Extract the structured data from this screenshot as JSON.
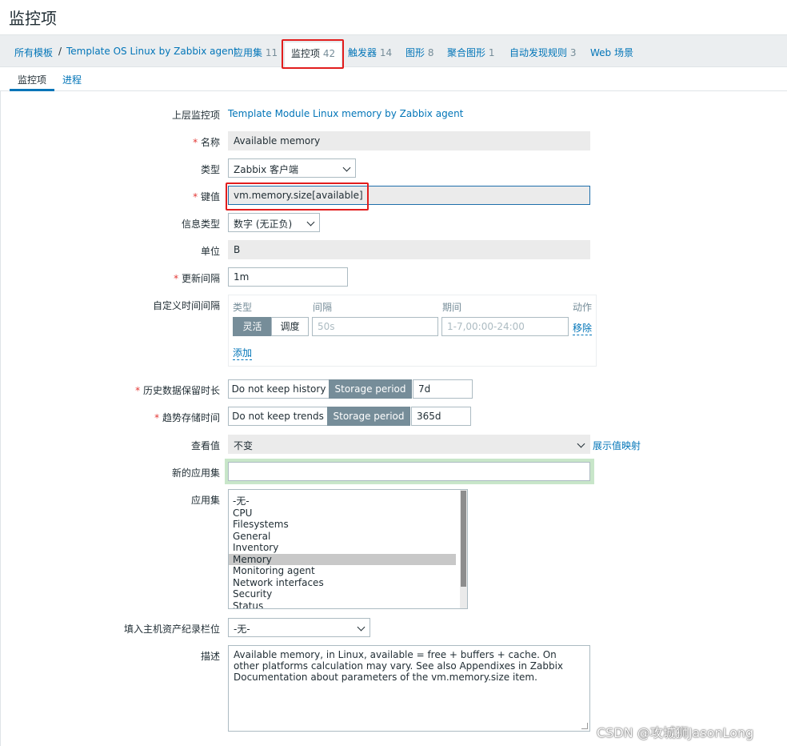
{
  "page": {
    "title": "监控项"
  },
  "breadcrumb": {
    "all_templates": "所有模板",
    "separator": "/",
    "template": "Template OS Linux by Zabbix agent"
  },
  "nav": [
    {
      "label": "应用集",
      "count": "11"
    },
    {
      "label": "监控项",
      "count": "42",
      "active": true
    },
    {
      "label": "触发器",
      "count": "14"
    },
    {
      "label": "图形",
      "count": "8"
    },
    {
      "label": "聚合图形",
      "count": "1"
    },
    {
      "label": "自动发现规则",
      "count": "3"
    },
    {
      "label": "Web 场景",
      "count": ""
    }
  ],
  "tabs": {
    "item": "监控项",
    "process": "进程"
  },
  "form": {
    "parent": {
      "label": "上层监控项",
      "value": "Template Module Linux memory by Zabbix agent"
    },
    "name": {
      "label": "名称",
      "value": "Available memory"
    },
    "type": {
      "label": "类型",
      "value": "Zabbix 客户端"
    },
    "key": {
      "label": "键值",
      "value": "vm.memory.size[available]"
    },
    "info_type": {
      "label": "信息类型",
      "value": "数字 (无正负)"
    },
    "units": {
      "label": "单位",
      "value": "B"
    },
    "update_interval": {
      "label": "更新间隔",
      "value": "1m"
    },
    "custom_intervals": {
      "label": "自定义时间间隔",
      "col_type": "类型",
      "col_interval": "间隔",
      "col_period": "期间",
      "col_action": "动作",
      "btn_flexible": "灵活",
      "btn_scheduling": "调度",
      "interval_placeholder": "50s",
      "period_placeholder": "1-7,00:00-24:00",
      "remove": "移除",
      "add": "添加"
    },
    "history": {
      "label": "历史数据保留时长",
      "btn_no_keep": "Do not keep history",
      "btn_storage": "Storage period",
      "value": "7d"
    },
    "trends": {
      "label": "趋势存储时间",
      "btn_no_keep": "Do not keep trends",
      "btn_storage": "Storage period",
      "value": "365d"
    },
    "valuemap": {
      "label": "查看值",
      "value": "不变",
      "link": "展示值映射"
    },
    "new_app": {
      "label": "新的应用集",
      "value": ""
    },
    "applications": {
      "label": "应用集",
      "options": [
        "-无-",
        "CPU",
        "Filesystems",
        "General",
        "Inventory",
        "Memory",
        "Monitoring agent",
        "Network interfaces",
        "Security",
        "Status"
      ],
      "selected": "Memory"
    },
    "inventory": {
      "label": "填入主机资产纪录栏位",
      "value": "-无-"
    },
    "description": {
      "label": "描述",
      "value": "Available memory, in Linux, available = free + buffers + cache. On other platforms calculation may vary. See also Appendixes in Zabbix Documentation about parameters of the vm.memory.size item."
    }
  },
  "watermark": "CSDN @攻城狮JasonLong",
  "colors": {
    "link": "#0275b8",
    "required": "#e33734",
    "highlight_box": "#e21d1d",
    "active_toggle": "#768d99"
  }
}
